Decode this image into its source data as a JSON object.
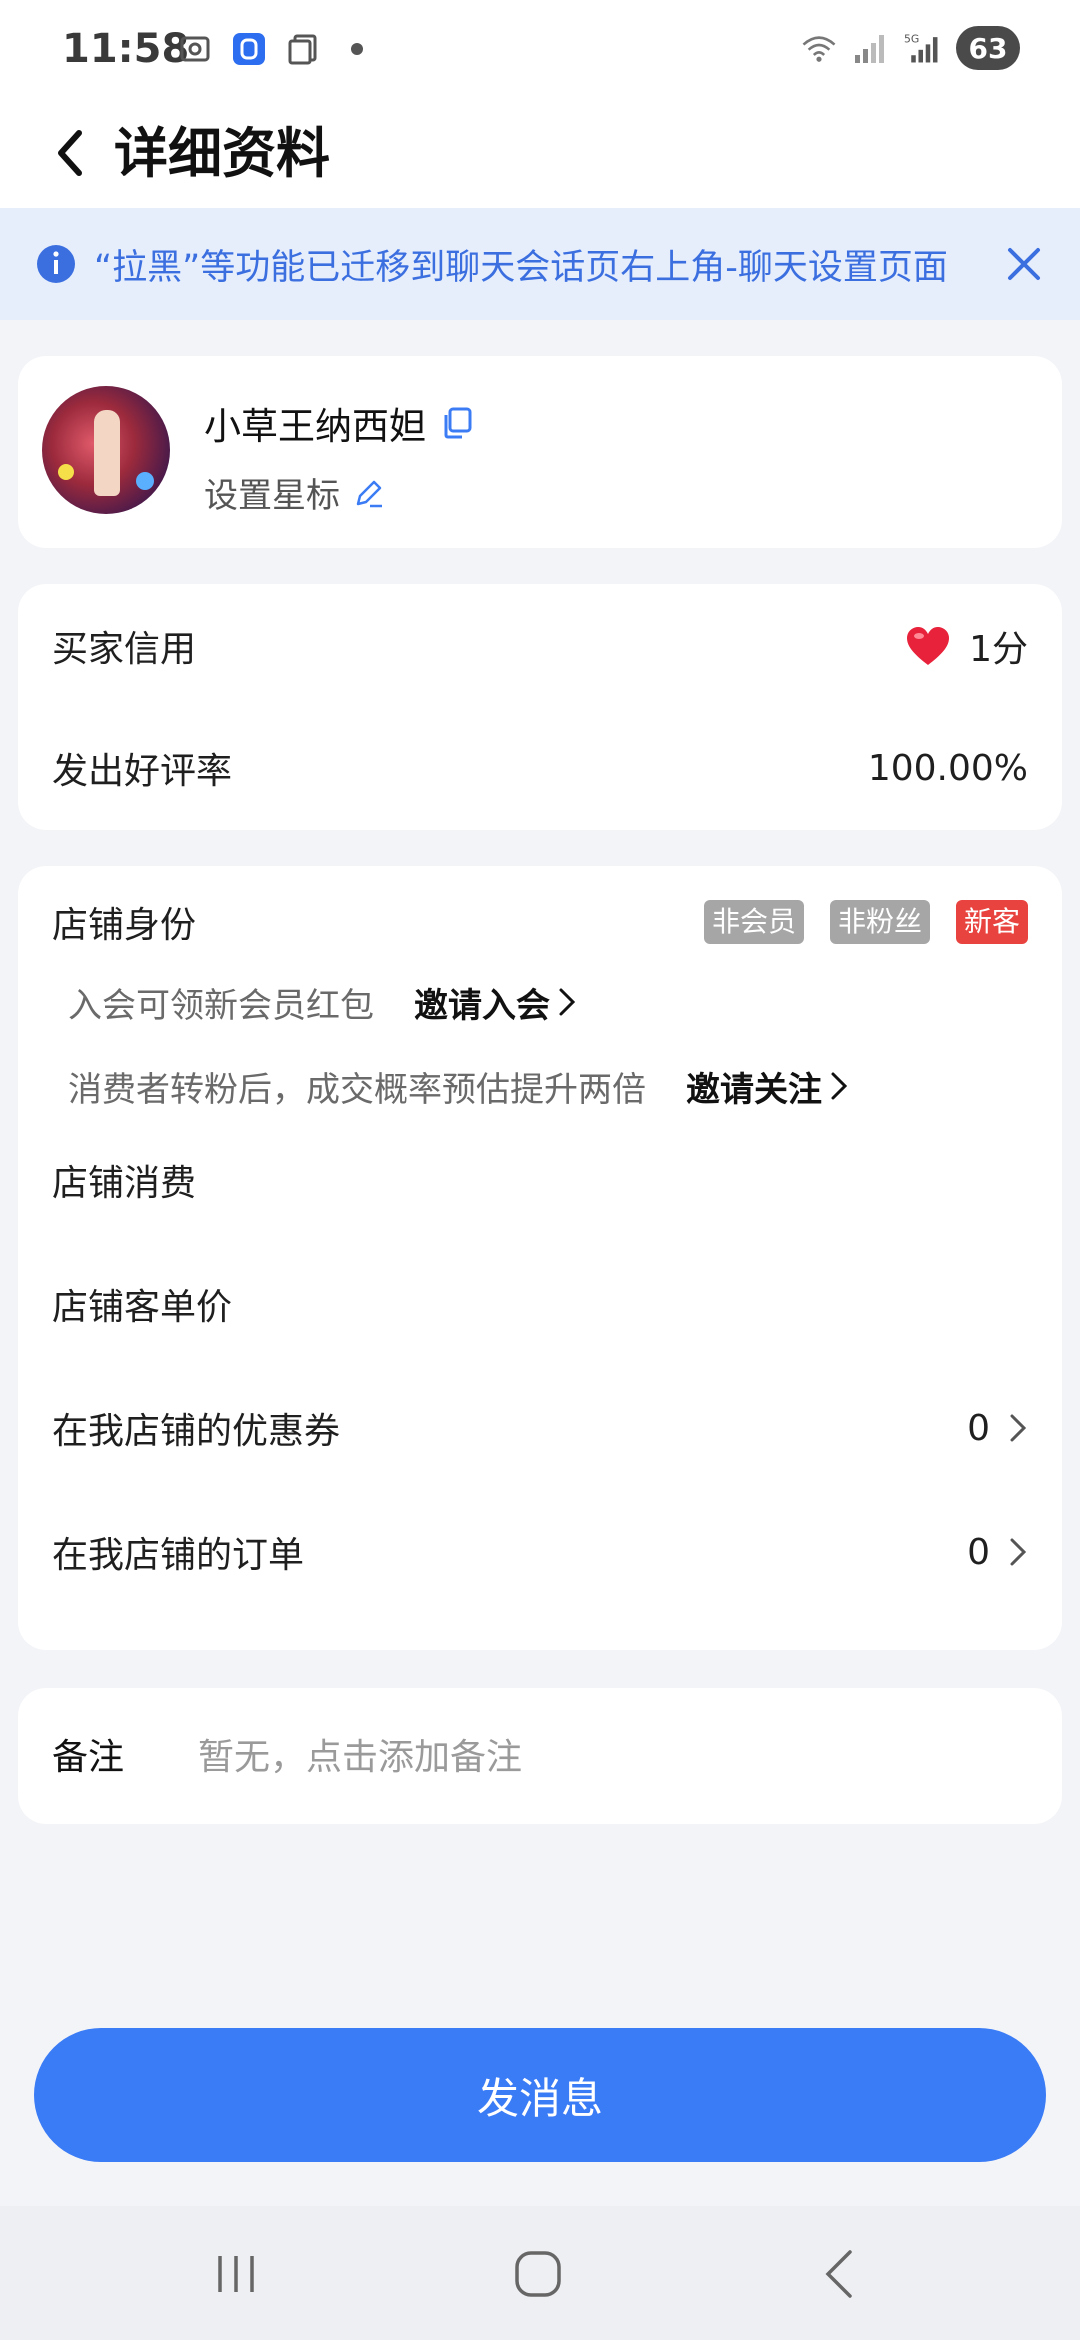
{
  "status_bar": {
    "time": "11:58",
    "battery": "63",
    "icons": [
      "screenshot-icon",
      "app-icon",
      "copy-icon",
      "dot-icon",
      "wifi-icon",
      "signal-icon",
      "signal-5g-icon"
    ]
  },
  "header": {
    "title": "详细资料"
  },
  "notice": {
    "text": "“拉黑”等功能已迁移到聊天会话页右上角-聊天设置页面",
    "accent": "#3b6fe0"
  },
  "profile": {
    "name": "小草王纳西妲",
    "star_label": "设置星标"
  },
  "credit": {
    "buyer_credit_label": "买家信用",
    "buyer_credit_value": "1分",
    "good_rate_label": "发出好评率",
    "good_rate_value": "100.00%"
  },
  "shop": {
    "identity_label": "店铺身份",
    "tags": [
      "非会员",
      "非粉丝",
      "新客"
    ],
    "member_hint": "入会可领新会员红包",
    "member_action": "邀请入会",
    "fan_hint": "消费者转粉后，成交概率预估提升两倍",
    "fan_action": "邀请关注",
    "consumption_label": "店铺消费",
    "avg_price_label": "店铺客单价",
    "coupons_label": "在我店铺的优惠券",
    "coupons_value": "0",
    "orders_label": "在我店铺的订单",
    "orders_value": "0"
  },
  "remark": {
    "label": "备注",
    "placeholder": "暂无，点击添加备注"
  },
  "actions": {
    "send_message": "发消息"
  },
  "colors": {
    "primary": "#3a7bf6",
    "tag_grey": "#a6a6a6",
    "tag_red": "#e8433f",
    "heart": "#e8223a"
  }
}
